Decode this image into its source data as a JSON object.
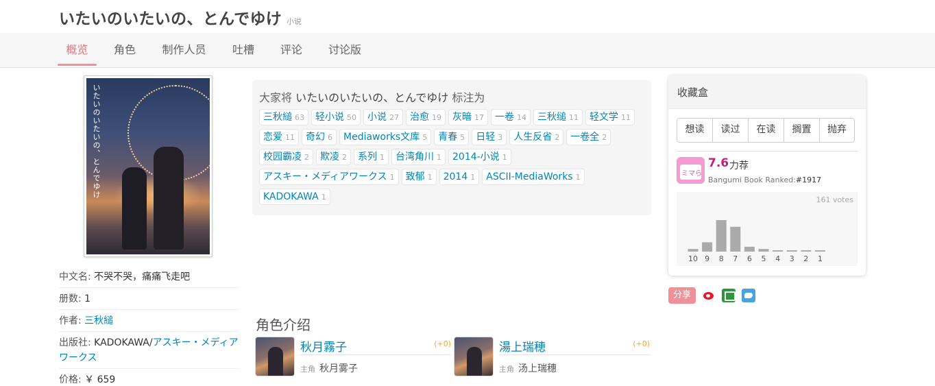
{
  "header": {
    "title": "いたいのいたいの、とんでゆけ",
    "type": "小说"
  },
  "tabs": [
    {
      "label": "概览",
      "active": true
    },
    {
      "label": "角色"
    },
    {
      "label": "制作人员"
    },
    {
      "label": "吐槽"
    },
    {
      "label": "评论"
    },
    {
      "label": "讨论版"
    }
  ],
  "cover": {
    "vertical_text": "いたいのいたいの、とんでゆけ"
  },
  "infobox": [
    {
      "key": "中文名: ",
      "value": "不哭不哭，痛痛飞走吧",
      "link": false
    },
    {
      "key": "册数: ",
      "value": "1",
      "link": false
    },
    {
      "key": "作者: ",
      "value": "三秋縋",
      "link": true
    },
    {
      "key": "出版社: ",
      "value": "KADOKAWA/",
      "link_value": "アスキー・メディアワークス"
    },
    {
      "key": "价格: ",
      "value": "￥ 659",
      "link": false
    }
  ],
  "tags_section": {
    "prefix": "大家将 ",
    "subject": "いたいのいたいの、とんでゆけ",
    "suffix": " 标注为",
    "tags": [
      {
        "name": "三秋縋",
        "count": "63"
      },
      {
        "name": "轻小说",
        "count": "50"
      },
      {
        "name": "小说",
        "count": "27"
      },
      {
        "name": "治愈",
        "count": "19"
      },
      {
        "name": "灰暗",
        "count": "17"
      },
      {
        "name": "一卷",
        "count": "14"
      },
      {
        "name": "三秋缒",
        "count": "11"
      },
      {
        "name": "轻文学",
        "count": "11"
      },
      {
        "name": "恋爱",
        "count": "11"
      },
      {
        "name": "奇幻",
        "count": "6"
      },
      {
        "name": "Mediaworks文库",
        "count": "5"
      },
      {
        "name": "青春",
        "count": "5"
      },
      {
        "name": "日轻",
        "count": "3"
      },
      {
        "name": "人生反省",
        "count": "2"
      },
      {
        "name": "一卷全",
        "count": "2"
      },
      {
        "name": "校园霸凌",
        "count": "2"
      },
      {
        "name": "欺凌",
        "count": "2"
      },
      {
        "name": "系列",
        "count": "1"
      },
      {
        "name": "台湾角川",
        "count": "1"
      },
      {
        "name": "2014-小说",
        "count": "1"
      },
      {
        "name": "アスキー・メディアワークス",
        "count": "1"
      },
      {
        "name": "致郁",
        "count": "1"
      },
      {
        "name": "2014",
        "count": "1"
      },
      {
        "name": "ASCII-MediaWorks",
        "count": "1"
      },
      {
        "name": "KADOKAWA",
        "count": "1"
      }
    ]
  },
  "characters": {
    "title": "角色介绍",
    "items": [
      {
        "name": "秋月霧子",
        "score": "(+0)",
        "role": "主角",
        "cn_name": "秋月雾子"
      },
      {
        "name": "湯上瑞穂",
        "score": "(+0)",
        "role": "主角",
        "cn_name": "汤上瑞穗"
      }
    ]
  },
  "collection": {
    "title": "收藏盒",
    "buttons": [
      "想读",
      "读过",
      "在读",
      "搁置",
      "抛弃"
    ],
    "badge_text": "ミマら",
    "score": "7.6",
    "score_label": "力荐",
    "rank_label": "Bangumi Book Ranked:",
    "rank_value": "#1917",
    "votes": "161 votes"
  },
  "chart_data": {
    "type": "bar",
    "categories": [
      "10",
      "9",
      "8",
      "7",
      "6",
      "5",
      "4",
      "3",
      "2",
      "1"
    ],
    "values": [
      6,
      21,
      71,
      56,
      11,
      6,
      3,
      2,
      1,
      1
    ],
    "ylim": [
      0,
      80
    ]
  },
  "share": {
    "label": "分享",
    "icons": [
      "weibo-icon",
      "douban-icon",
      "twitter-icon"
    ]
  },
  "colors": {
    "accent": "#f09199",
    "link": "#0084b4",
    "score": "#c2207a",
    "bar": "#aaaaaa"
  }
}
